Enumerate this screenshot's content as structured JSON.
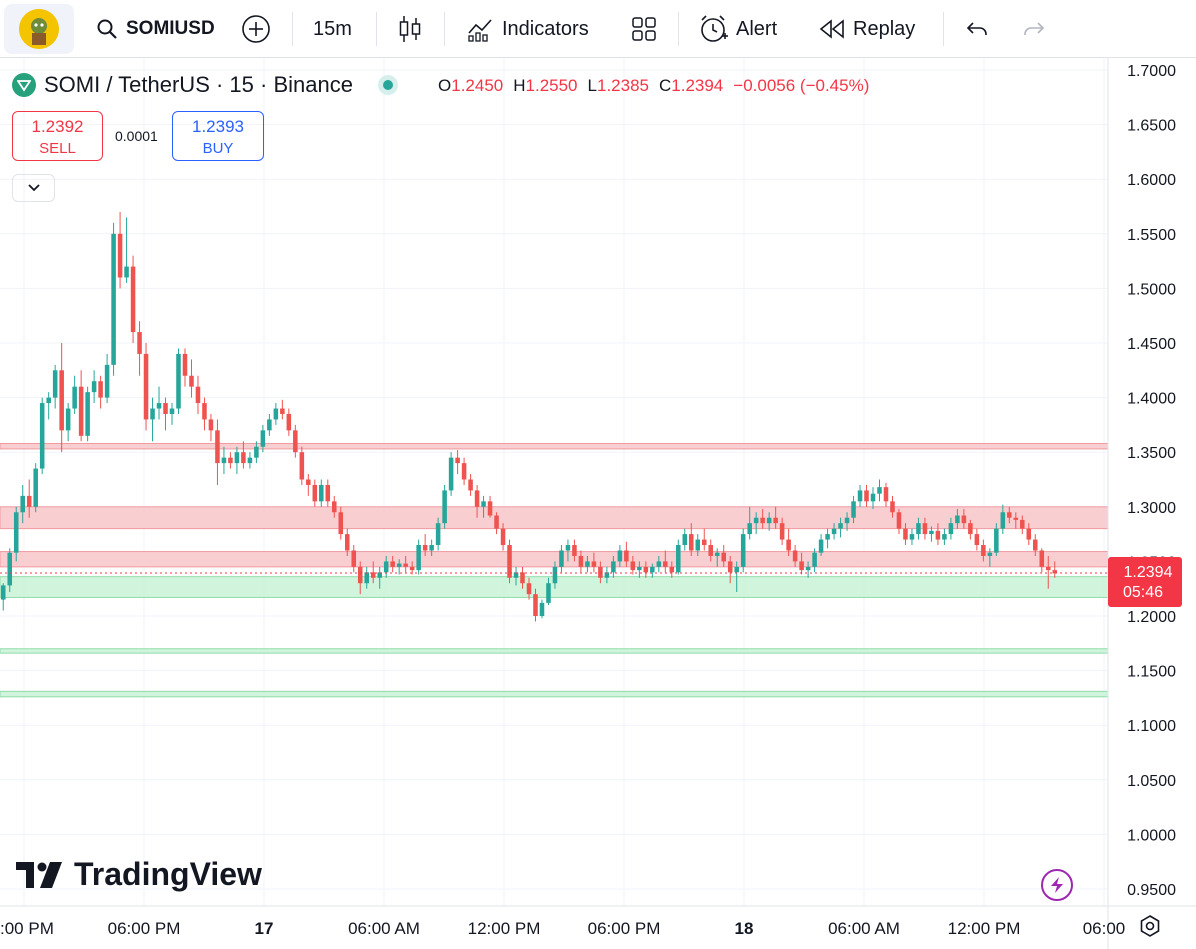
{
  "toolbar": {
    "symbol": "SOMIUSD",
    "interval": "15m",
    "indicators_label": "Indicators",
    "alert_label": "Alert",
    "replay_label": "Replay"
  },
  "legend": {
    "title": "SOMI / TetherUS · 15 · Binance",
    "o_label": "O",
    "o_value": "1.2450",
    "h_label": "H",
    "h_value": "1.2550",
    "l_label": "L",
    "l_value": "1.2385",
    "c_label": "C",
    "c_value": "1.2394",
    "change": "−0.0056 (−0.45%)"
  },
  "trade": {
    "sell_price": "1.2392",
    "sell_label": "SELL",
    "spread": "0.0001",
    "buy_price": "1.2393",
    "buy_label": "BUY"
  },
  "price_tag": {
    "price": "1.2394",
    "countdown": "05:46"
  },
  "watermark": "TradingView",
  "colors": {
    "up": "#26a69a",
    "down": "#ef5350",
    "resistance_zone": "#f7c5c9",
    "support_zone": "#c8f2d6",
    "price_tag": "#f23645"
  },
  "chart_data": {
    "type": "candlestick",
    "ylim": [
      0.93,
      1.72
    ],
    "y_ticks": [
      "1.7000",
      "1.6500",
      "1.6000",
      "1.5500",
      "1.5000",
      "1.4500",
      "1.4000",
      "1.3500",
      "1.3000",
      "1.2500",
      "1.2000",
      "1.1500",
      "1.1000",
      "1.0500",
      "1.0000",
      "0.9500"
    ],
    "x_ticks": [
      {
        "label": ":00 PM",
        "t": 0.05
      },
      {
        "label": "06:00 PM",
        "t": 1.05
      },
      {
        "label": "17",
        "t": 2.05
      },
      {
        "label": "06:00 AM",
        "t": 3.05
      },
      {
        "label": "12:00 PM",
        "t": 4.05
      },
      {
        "label": "06:00 PM",
        "t": 5.05
      },
      {
        "label": "18",
        "t": 6.05
      },
      {
        "label": "06:00 AM",
        "t": 7.05
      },
      {
        "label": "12:00 PM",
        "t": 8.05
      },
      {
        "label": "06:00",
        "t": 9.05
      }
    ],
    "zones": [
      {
        "type": "resistance",
        "from": 1.353,
        "to": 1.358
      },
      {
        "type": "resistance",
        "from": 1.28,
        "to": 1.3
      },
      {
        "type": "resistance",
        "from": 1.245,
        "to": 1.259
      },
      {
        "type": "support",
        "from": 1.217,
        "to": 1.236
      },
      {
        "type": "support",
        "from": 1.166,
        "to": 1.17
      },
      {
        "type": "support",
        "from": 1.126,
        "to": 1.131
      }
    ],
    "current_price": 1.2394,
    "candles": [
      [
        1.215,
        1.23,
        1.205,
        1.228
      ],
      [
        1.228,
        1.262,
        1.222,
        1.258
      ],
      [
        1.258,
        1.3,
        1.25,
        1.295
      ],
      [
        1.295,
        1.32,
        1.285,
        1.31
      ],
      [
        1.31,
        1.325,
        1.29,
        1.3
      ],
      [
        1.3,
        1.34,
        1.295,
        1.335
      ],
      [
        1.335,
        1.4,
        1.33,
        1.395
      ],
      [
        1.395,
        1.405,
        1.38,
        1.4
      ],
      [
        1.4,
        1.43,
        1.39,
        1.425
      ],
      [
        1.425,
        1.45,
        1.35,
        1.37
      ],
      [
        1.37,
        1.395,
        1.36,
        1.39
      ],
      [
        1.39,
        1.42,
        1.385,
        1.41
      ],
      [
        1.41,
        1.425,
        1.36,
        1.365
      ],
      [
        1.365,
        1.41,
        1.36,
        1.405
      ],
      [
        1.405,
        1.425,
        1.395,
        1.415
      ],
      [
        1.415,
        1.42,
        1.39,
        1.4
      ],
      [
        1.4,
        1.44,
        1.395,
        1.43
      ],
      [
        1.43,
        1.56,
        1.42,
        1.55
      ],
      [
        1.55,
        1.57,
        1.5,
        1.51
      ],
      [
        1.51,
        1.565,
        1.505,
        1.52
      ],
      [
        1.52,
        1.53,
        1.45,
        1.46
      ],
      [
        1.46,
        1.47,
        1.42,
        1.44
      ],
      [
        1.44,
        1.45,
        1.37,
        1.38
      ],
      [
        1.38,
        1.4,
        1.36,
        1.39
      ],
      [
        1.39,
        1.41,
        1.38,
        1.395
      ],
      [
        1.395,
        1.4,
        1.37,
        1.385
      ],
      [
        1.385,
        1.395,
        1.375,
        1.39
      ],
      [
        1.39,
        1.445,
        1.385,
        1.44
      ],
      [
        1.44,
        1.445,
        1.41,
        1.42
      ],
      [
        1.42,
        1.435,
        1.4,
        1.41
      ],
      [
        1.41,
        1.42,
        1.385,
        1.395
      ],
      [
        1.395,
        1.4,
        1.37,
        1.38
      ],
      [
        1.38,
        1.385,
        1.36,
        1.37
      ],
      [
        1.37,
        1.38,
        1.32,
        1.34
      ],
      [
        1.34,
        1.355,
        1.33,
        1.345
      ],
      [
        1.345,
        1.35,
        1.335,
        1.34
      ],
      [
        1.34,
        1.355,
        1.33,
        1.35
      ],
      [
        1.35,
        1.36,
        1.335,
        1.34
      ],
      [
        1.34,
        1.35,
        1.335,
        1.345
      ],
      [
        1.345,
        1.36,
        1.34,
        1.355
      ],
      [
        1.355,
        1.375,
        1.35,
        1.37
      ],
      [
        1.37,
        1.385,
        1.365,
        1.38
      ],
      [
        1.38,
        1.395,
        1.375,
        1.39
      ],
      [
        1.39,
        1.398,
        1.38,
        1.385
      ],
      [
        1.385,
        1.39,
        1.365,
        1.37
      ],
      [
        1.37,
        1.375,
        1.345,
        1.35
      ],
      [
        1.35,
        1.355,
        1.32,
        1.325
      ],
      [
        1.325,
        1.33,
        1.31,
        1.32
      ],
      [
        1.32,
        1.325,
        1.3,
        1.305
      ],
      [
        1.305,
        1.325,
        1.3,
        1.32
      ],
      [
        1.32,
        1.325,
        1.3,
        1.305
      ],
      [
        1.305,
        1.31,
        1.29,
        1.295
      ],
      [
        1.295,
        1.3,
        1.27,
        1.275
      ],
      [
        1.275,
        1.28,
        1.255,
        1.26
      ],
      [
        1.26,
        1.265,
        1.24,
        1.245
      ],
      [
        1.245,
        1.25,
        1.22,
        1.23
      ],
      [
        1.23,
        1.245,
        1.225,
        1.24
      ],
      [
        1.24,
        1.25,
        1.23,
        1.235
      ],
      [
        1.235,
        1.245,
        1.225,
        1.24
      ],
      [
        1.24,
        1.255,
        1.235,
        1.25
      ],
      [
        1.25,
        1.255,
        1.24,
        1.245
      ],
      [
        1.245,
        1.252,
        1.238,
        1.248
      ],
      [
        1.248,
        1.255,
        1.24,
        1.245
      ],
      [
        1.245,
        1.25,
        1.238,
        1.242
      ],
      [
        1.242,
        1.27,
        1.238,
        1.265
      ],
      [
        1.265,
        1.275,
        1.255,
        1.26
      ],
      [
        1.26,
        1.27,
        1.255,
        1.265
      ],
      [
        1.265,
        1.29,
        1.26,
        1.285
      ],
      [
        1.285,
        1.32,
        1.28,
        1.315
      ],
      [
        1.315,
        1.35,
        1.31,
        1.345
      ],
      [
        1.345,
        1.352,
        1.33,
        1.34
      ],
      [
        1.34,
        1.345,
        1.32,
        1.325
      ],
      [
        1.325,
        1.33,
        1.31,
        1.315
      ],
      [
        1.315,
        1.32,
        1.29,
        1.3
      ],
      [
        1.3,
        1.31,
        1.29,
        1.305
      ],
      [
        1.305,
        1.31,
        1.29,
        1.292
      ],
      [
        1.292,
        1.295,
        1.275,
        1.28
      ],
      [
        1.28,
        1.285,
        1.26,
        1.265
      ],
      [
        1.265,
        1.27,
        1.23,
        1.235
      ],
      [
        1.235,
        1.245,
        1.228,
        1.24
      ],
      [
        1.24,
        1.245,
        1.225,
        1.23
      ],
      [
        1.23,
        1.235,
        1.215,
        1.22
      ],
      [
        1.22,
        1.225,
        1.195,
        1.2
      ],
      [
        1.2,
        1.215,
        1.198,
        1.212
      ],
      [
        1.212,
        1.235,
        1.21,
        1.23
      ],
      [
        1.23,
        1.25,
        1.225,
        1.245
      ],
      [
        1.245,
        1.265,
        1.24,
        1.26
      ],
      [
        1.26,
        1.27,
        1.25,
        1.265
      ],
      [
        1.265,
        1.27,
        1.25,
        1.255
      ],
      [
        1.255,
        1.26,
        1.24,
        1.245
      ],
      [
        1.245,
        1.255,
        1.24,
        1.25
      ],
      [
        1.25,
        1.258,
        1.24,
        1.245
      ],
      [
        1.245,
        1.25,
        1.23,
        1.235
      ],
      [
        1.235,
        1.245,
        1.23,
        1.24
      ],
      [
        1.24,
        1.255,
        1.235,
        1.25
      ],
      [
        1.25,
        1.265,
        1.245,
        1.26
      ],
      [
        1.26,
        1.268,
        1.245,
        1.25
      ],
      [
        1.25,
        1.255,
        1.238,
        1.242
      ],
      [
        1.242,
        1.25,
        1.235,
        1.245
      ],
      [
        1.245,
        1.25,
        1.235,
        1.24
      ],
      [
        1.24,
        1.248,
        1.235,
        1.245
      ],
      [
        1.245,
        1.255,
        1.24,
        1.25
      ],
      [
        1.25,
        1.26,
        1.24,
        1.245
      ],
      [
        1.245,
        1.25,
        1.235,
        1.24
      ],
      [
        1.24,
        1.27,
        1.238,
        1.265
      ],
      [
        1.265,
        1.28,
        1.26,
        1.275
      ],
      [
        1.275,
        1.285,
        1.255,
        1.26
      ],
      [
        1.26,
        1.275,
        1.255,
        1.27
      ],
      [
        1.27,
        1.28,
        1.26,
        1.265
      ],
      [
        1.265,
        1.27,
        1.25,
        1.255
      ],
      [
        1.255,
        1.262,
        1.245,
        1.258
      ],
      [
        1.258,
        1.265,
        1.245,
        1.25
      ],
      [
        1.25,
        1.255,
        1.23,
        1.24
      ],
      [
        1.24,
        1.25,
        1.222,
        1.245
      ],
      [
        1.245,
        1.28,
        1.24,
        1.275
      ],
      [
        1.275,
        1.3,
        1.27,
        1.285
      ],
      [
        1.285,
        1.295,
        1.275,
        1.29
      ],
      [
        1.29,
        1.298,
        1.28,
        1.285
      ],
      [
        1.285,
        1.295,
        1.278,
        1.29
      ],
      [
        1.29,
        1.3,
        1.28,
        1.285
      ],
      [
        1.285,
        1.29,
        1.265,
        1.27
      ],
      [
        1.27,
        1.28,
        1.255,
        1.26
      ],
      [
        1.26,
        1.265,
        1.245,
        1.25
      ],
      [
        1.25,
        1.258,
        1.238,
        1.242
      ],
      [
        1.242,
        1.25,
        1.235,
        1.245
      ],
      [
        1.245,
        1.262,
        1.24,
        1.258
      ],
      [
        1.258,
        1.275,
        1.255,
        1.27
      ],
      [
        1.27,
        1.28,
        1.262,
        1.275
      ],
      [
        1.275,
        1.285,
        1.27,
        1.28
      ],
      [
        1.28,
        1.29,
        1.272,
        1.285
      ],
      [
        1.285,
        1.295,
        1.278,
        1.29
      ],
      [
        1.29,
        1.31,
        1.285,
        1.305
      ],
      [
        1.305,
        1.32,
        1.3,
        1.315
      ],
      [
        1.315,
        1.32,
        1.3,
        1.305
      ],
      [
        1.305,
        1.318,
        1.298,
        1.312
      ],
      [
        1.312,
        1.325,
        1.305,
        1.318
      ],
      [
        1.318,
        1.322,
        1.3,
        1.305
      ],
      [
        1.305,
        1.31,
        1.29,
        1.295
      ],
      [
        1.295,
        1.298,
        1.275,
        1.28
      ],
      [
        1.28,
        1.285,
        1.265,
        1.27
      ],
      [
        1.27,
        1.28,
        1.265,
        1.275
      ],
      [
        1.275,
        1.29,
        1.27,
        1.285
      ],
      [
        1.285,
        1.29,
        1.27,
        1.275
      ],
      [
        1.275,
        1.282,
        1.268,
        1.278
      ],
      [
        1.278,
        1.285,
        1.265,
        1.27
      ],
      [
        1.27,
        1.28,
        1.265,
        1.275
      ],
      [
        1.275,
        1.29,
        1.27,
        1.285
      ],
      [
        1.285,
        1.298,
        1.28,
        1.292
      ],
      [
        1.292,
        1.298,
        1.28,
        1.285
      ],
      [
        1.285,
        1.288,
        1.27,
        1.275
      ],
      [
        1.275,
        1.28,
        1.26,
        1.265
      ],
      [
        1.265,
        1.27,
        1.25,
        1.255
      ],
      [
        1.255,
        1.262,
        1.245,
        1.258
      ],
      [
        1.258,
        1.285,
        1.255,
        1.28
      ],
      [
        1.28,
        1.302,
        1.275,
        1.295
      ],
      [
        1.295,
        1.3,
        1.285,
        1.29
      ],
      [
        1.29,
        1.295,
        1.28,
        1.288
      ],
      [
        1.288,
        1.292,
        1.275,
        1.28
      ],
      [
        1.28,
        1.285,
        1.265,
        1.27
      ],
      [
        1.27,
        1.275,
        1.255,
        1.26
      ],
      [
        1.26,
        1.262,
        1.24,
        1.245
      ],
      [
        1.245,
        1.255,
        1.225,
        1.242
      ],
      [
        1.242,
        1.25,
        1.235,
        1.239
      ]
    ]
  }
}
